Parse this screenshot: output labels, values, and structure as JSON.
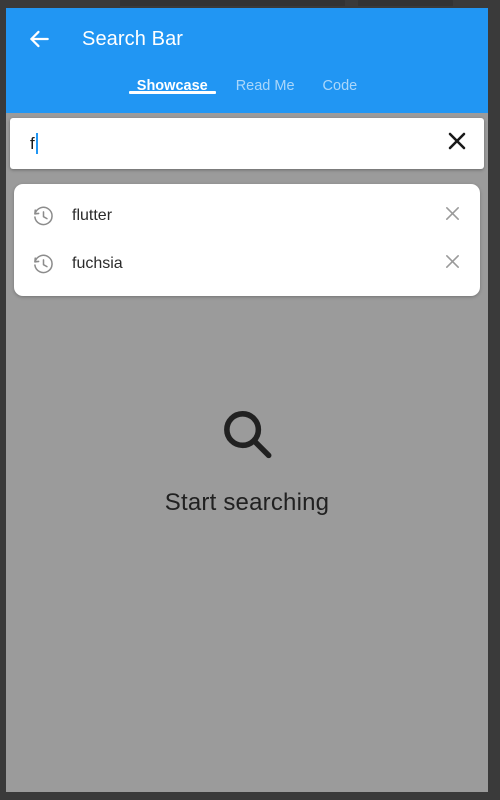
{
  "appbar": {
    "back_icon": "arrow-back-icon",
    "title": "Search Bar",
    "background_color": "#2196F3",
    "tabs": [
      {
        "label": "Showcase",
        "active": true
      },
      {
        "label": "Read Me",
        "active": false
      },
      {
        "label": "Code",
        "active": false
      }
    ]
  },
  "search": {
    "value": "f",
    "placeholder": "",
    "clear_icon": "close-icon",
    "caret_color": "#2196F3"
  },
  "suggestions": {
    "items": [
      {
        "label": "flutter",
        "leading_icon": "history-icon",
        "trailing_icon": "close-icon"
      },
      {
        "label": "fuchsia",
        "leading_icon": "history-icon",
        "trailing_icon": "close-icon"
      }
    ]
  },
  "empty_state": {
    "icon": "search-icon",
    "label": "Start searching"
  },
  "body": {
    "background_color": "#9B9B9B"
  }
}
